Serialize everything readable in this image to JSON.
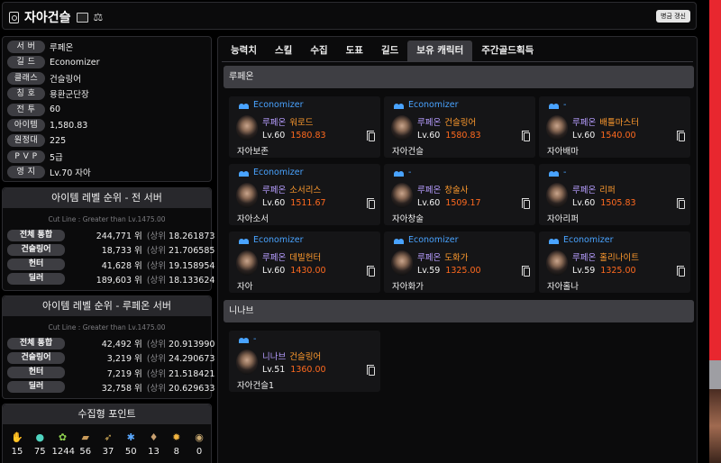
{
  "header": {
    "title": "자아건슬",
    "refresh_label": "병금 갱신"
  },
  "info": [
    {
      "label": "서 버",
      "value": "루페온"
    },
    {
      "label": "길 드",
      "value": "Economizer"
    },
    {
      "label": "클래스",
      "value": "건슬링어"
    },
    {
      "label": "칭 호",
      "value": "용환군단장"
    },
    {
      "label": "전 투",
      "value": "60"
    },
    {
      "label": "아이템",
      "value": "1,580.83"
    },
    {
      "label": "원정대",
      "value": "225"
    },
    {
      "label": "P V P",
      "value": "5급"
    },
    {
      "label": "영 지",
      "value": "Lv.70 자아"
    }
  ],
  "rank_all": {
    "title": "아이템 레벨 순위 - 전 서버",
    "cutline": "Cut Line : Greater than Lv.1475.00",
    "rows": [
      {
        "label": "전체 통합",
        "rank": "244,771",
        "wi": "위",
        "sang": "(상위",
        "pct": "18.261873 %)"
      },
      {
        "label": "건슬링어",
        "rank": "18,733",
        "wi": "위",
        "sang": "(상위",
        "pct": "21.706585 %)"
      },
      {
        "label": "헌터",
        "rank": "41,628",
        "wi": "위",
        "sang": "(상위",
        "pct": "19.158954 %)"
      },
      {
        "label": "딜러",
        "rank": "189,603",
        "wi": "위",
        "sang": "(상위",
        "pct": "18.133624 %)"
      }
    ]
  },
  "rank_server": {
    "title": "아이템 레벨 순위 - 루페온 서버",
    "cutline": "Cut Line : Greater than Lv.1475.00",
    "rows": [
      {
        "label": "전체 통합",
        "rank": "42,492",
        "wi": "위",
        "sang": "(상위",
        "pct": "20.913990 %)"
      },
      {
        "label": "건슬링어",
        "rank": "3,219",
        "wi": "위",
        "sang": "(상위",
        "pct": "24.290673 %)"
      },
      {
        "label": "헌터",
        "rank": "7,219",
        "wi": "위",
        "sang": "(상위",
        "pct": "21.518421 %)"
      },
      {
        "label": "딜러",
        "rank": "32,758",
        "wi": "위",
        "sang": "(상위",
        "pct": "20.629633 %)"
      }
    ]
  },
  "collect": {
    "title": "수집형 포인트",
    "items": [
      {
        "icon": "mokoko-seed-icon",
        "glyph": "✋",
        "color": "#d8d8d8",
        "value": "15"
      },
      {
        "icon": "island-heart-icon",
        "glyph": "●",
        "color": "#4fd4c0",
        "value": "75"
      },
      {
        "icon": "mokoko-icon",
        "glyph": "✿",
        "color": "#8fd14f",
        "value": "1244"
      },
      {
        "icon": "adventure-book-icon",
        "glyph": "▰",
        "color": "#c89a5a",
        "value": "56"
      },
      {
        "icon": "voyage-icon",
        "glyph": "➶",
        "color": "#d9b25a",
        "value": "37"
      },
      {
        "icon": "art-icon",
        "glyph": "✱",
        "color": "#5aa8ff",
        "value": "50"
      },
      {
        "icon": "giant-heart-icon",
        "glyph": "♦",
        "color": "#c8a070",
        "value": "13"
      },
      {
        "icon": "ignea-icon",
        "glyph": "✹",
        "color": "#f2b440",
        "value": "8"
      },
      {
        "icon": "orpheus-icon",
        "glyph": "◉",
        "color": "#c8a870",
        "value": "0"
      }
    ]
  },
  "tabs": [
    "능력치",
    "스킬",
    "수집",
    "도표",
    "길드",
    "보유 캐릭터",
    "주간골드획득"
  ],
  "servers": [
    {
      "name": "루페온",
      "chars": [
        {
          "guild": "Economizer",
          "server": "루페온",
          "cls": "워로드",
          "level": "Lv.60",
          "item": "1580.83",
          "name": "자아보존"
        },
        {
          "guild": "Economizer",
          "server": "루페온",
          "cls": "건슬링어",
          "level": "Lv.60",
          "item": "1580.83",
          "name": "자아건슬"
        },
        {
          "guild": "-",
          "server": "루페온",
          "cls": "배틀마스터",
          "level": "Lv.60",
          "item": "1540.00",
          "name": "자아배마"
        },
        {
          "guild": "Economizer",
          "server": "루페온",
          "cls": "소서리스",
          "level": "Lv.60",
          "item": "1511.67",
          "name": "자아소서"
        },
        {
          "guild": "-",
          "server": "루페온",
          "cls": "창술사",
          "level": "Lv.60",
          "item": "1509.17",
          "name": "자아창술"
        },
        {
          "guild": "-",
          "server": "루페온",
          "cls": "리퍼",
          "level": "Lv.60",
          "item": "1505.83",
          "name": "자아리퍼"
        },
        {
          "guild": "Economizer",
          "server": "루페온",
          "cls": "데빌헌터",
          "level": "Lv.60",
          "item": "1430.00",
          "name": "자아"
        },
        {
          "guild": "Economizer",
          "server": "루페온",
          "cls": "도화가",
          "level": "Lv.59",
          "item": "1325.00",
          "name": "자아화가"
        },
        {
          "guild": "Economizer",
          "server": "루페온",
          "cls": "홀리나이트",
          "level": "Lv.59",
          "item": "1325.00",
          "name": "자아홀나"
        }
      ]
    },
    {
      "name": "니나브",
      "chars": [
        {
          "guild": "-",
          "server": "니나브",
          "cls": "건슬링어",
          "level": "Lv.51",
          "item": "1360.00",
          "name": "자아건슬1"
        }
      ]
    }
  ]
}
